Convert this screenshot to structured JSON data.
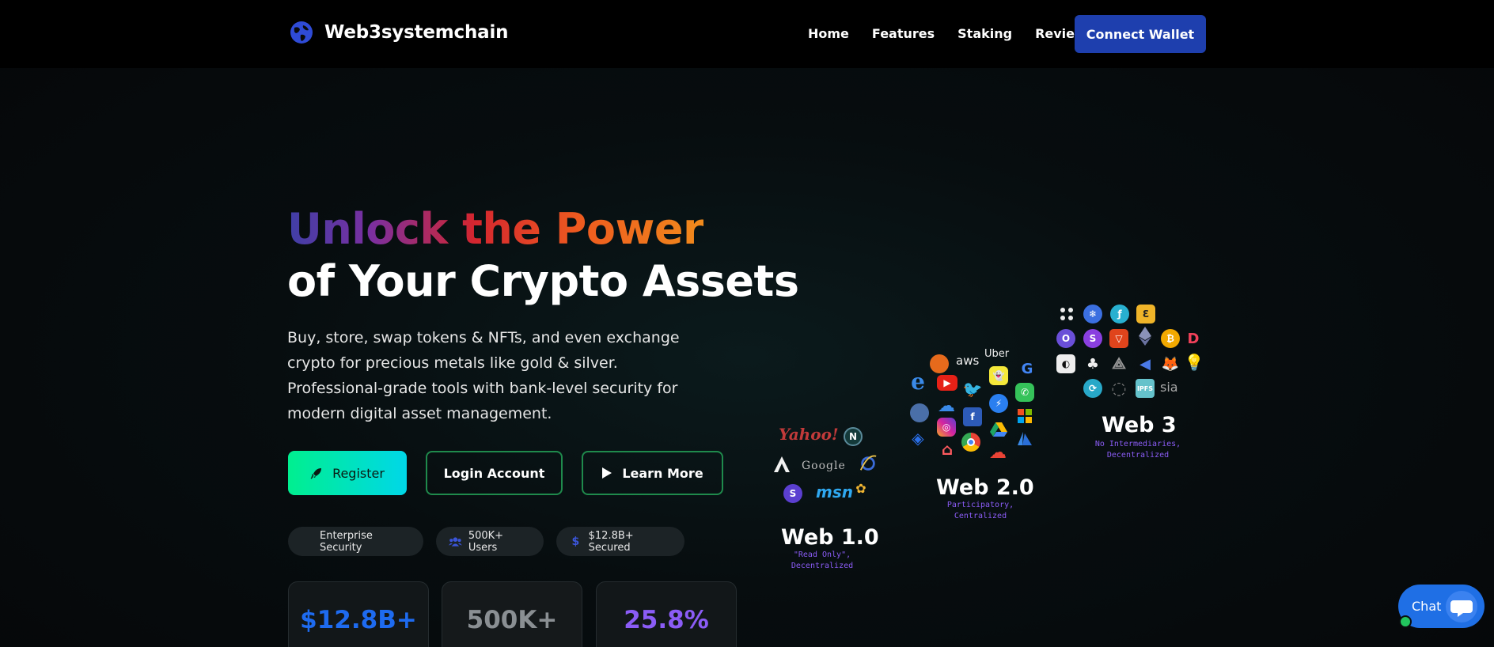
{
  "header": {
    "brand": "Web3systemchain",
    "nav": [
      "Home",
      "Features",
      "Staking",
      "Reviews"
    ],
    "connect_label": "Connect Wallet"
  },
  "hero": {
    "title_line1": "Unlock the Power",
    "title_line2": "of Your Crypto Assets",
    "description": "Buy, store, swap tokens & NFTs, and even exchange crypto for precious metals like gold & silver. Professional-grade tools with bank-level security for modern digital asset management.",
    "buttons": {
      "register": "Register",
      "login": "Login Account",
      "learn": "Learn More"
    },
    "badges": [
      "Enterprise Security",
      "500K+ Users",
      "$12.8B+ Secured"
    ],
    "stats": [
      {
        "value": "$12.8B+",
        "color": "#1e6bf0"
      },
      {
        "value": "500K+",
        "color": "#8a8f93"
      },
      {
        "value": "25.8%",
        "color": "#8b5cf6"
      }
    ]
  },
  "web_evolution": {
    "web1": {
      "title": "Web 1.0",
      "subtitle_l1": "\"Read Only\",",
      "subtitle_l2": "Decentralized",
      "logos": [
        "Yahoo!",
        "Google",
        "msn",
        "netscape-icon",
        "ie-icon",
        "altavista-icon",
        "skype-icon",
        "msn-butterfly-icon"
      ]
    },
    "web2": {
      "title": "Web 2.0",
      "subtitle_l1": "Participatory,",
      "subtitle_l2": "Centralized",
      "logos": [
        "aws",
        "Uber",
        "firefox-icon",
        "google-icon",
        "ie-icon",
        "youtube-icon",
        "twitter-icon",
        "snapchat-icon",
        "whatsapp-icon",
        "icloud-icon",
        "facebook-icon",
        "messenger-icon",
        "microsoft-icon",
        "globe-icon",
        "instagram-icon",
        "drive-icon",
        "dropbox-icon",
        "airbnb-icon",
        "chrome-icon",
        "gcloud-icon",
        "azure-icon"
      ]
    },
    "web3": {
      "title": "Web 3",
      "subtitle_l1": "No Intermediaries,",
      "subtitle_l2": "Decentralized",
      "logos": [
        "sia",
        "polkadot-icon",
        "filecoin-icon",
        "eos-icon",
        "ethereum-icon",
        "bitcoin-icon",
        "brave-icon",
        "metamask-icon",
        "arweave-icon",
        "chainlink-icon",
        "orchid-icon",
        "ipfs-icon"
      ]
    }
  },
  "chat": {
    "label": "Chat"
  },
  "colors": {
    "accent": "#1e3fae",
    "register_gradient_start": "#00ef8f",
    "register_gradient_end": "#00d7e8",
    "chat": "#1f6fe5"
  }
}
